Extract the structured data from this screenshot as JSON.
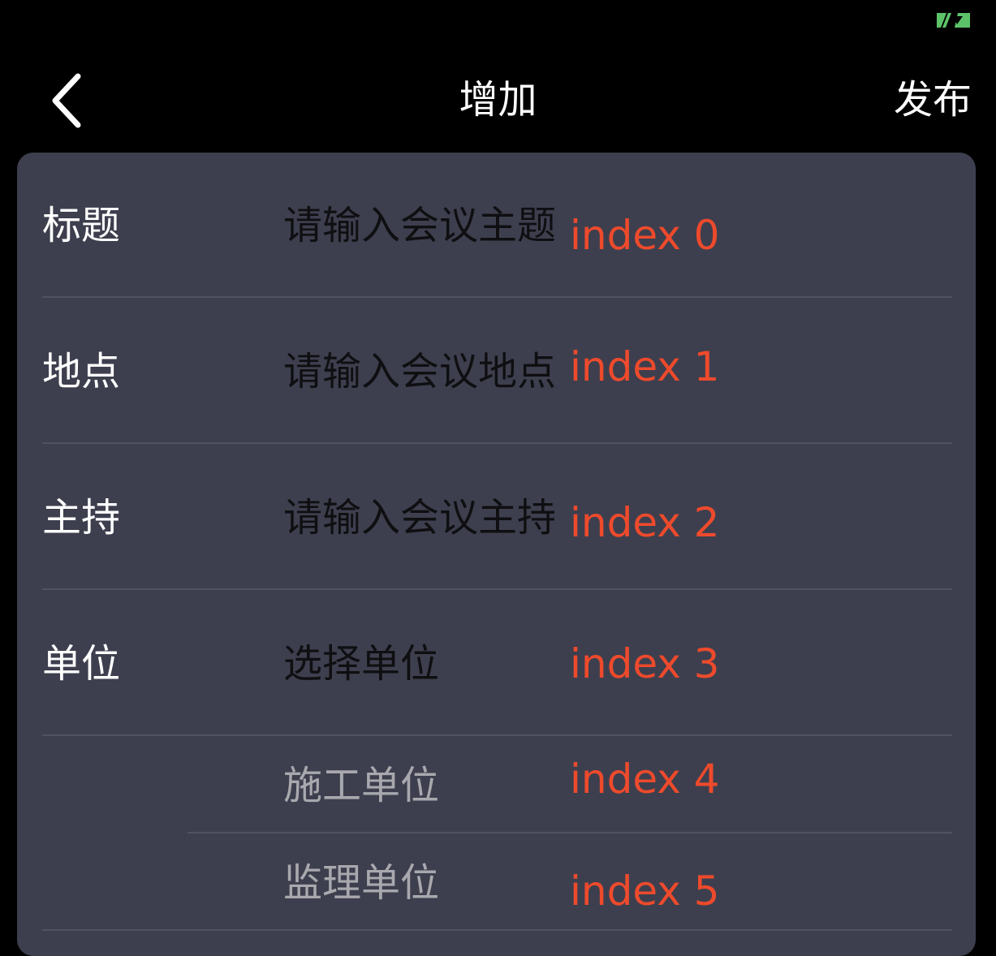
{
  "status": {
    "icon": "battery-charging-icon",
    "icon_color": "#5cc26a"
  },
  "nav": {
    "back_icon": "chevron-left-icon",
    "title": "增加",
    "publish_label": "发布"
  },
  "colors": {
    "card_background": "#3d3f4e",
    "index_text": "#ee4a2c",
    "divider": "#4f5262"
  },
  "form": {
    "rows": [
      {
        "label": "标题",
        "placeholder": "请输入会议主题",
        "index": "index 0"
      },
      {
        "label": "地点",
        "placeholder": "请输入会议地点",
        "index": "index 1"
      },
      {
        "label": "主持",
        "placeholder": "请输入会议主持",
        "index": "index 2"
      },
      {
        "label": "单位",
        "placeholder": "选择单位",
        "index": "index 3"
      },
      {
        "label": "",
        "option": "施工单位",
        "index": "index 4"
      },
      {
        "label": "",
        "option": "监理单位",
        "index": "index 5"
      }
    ]
  }
}
